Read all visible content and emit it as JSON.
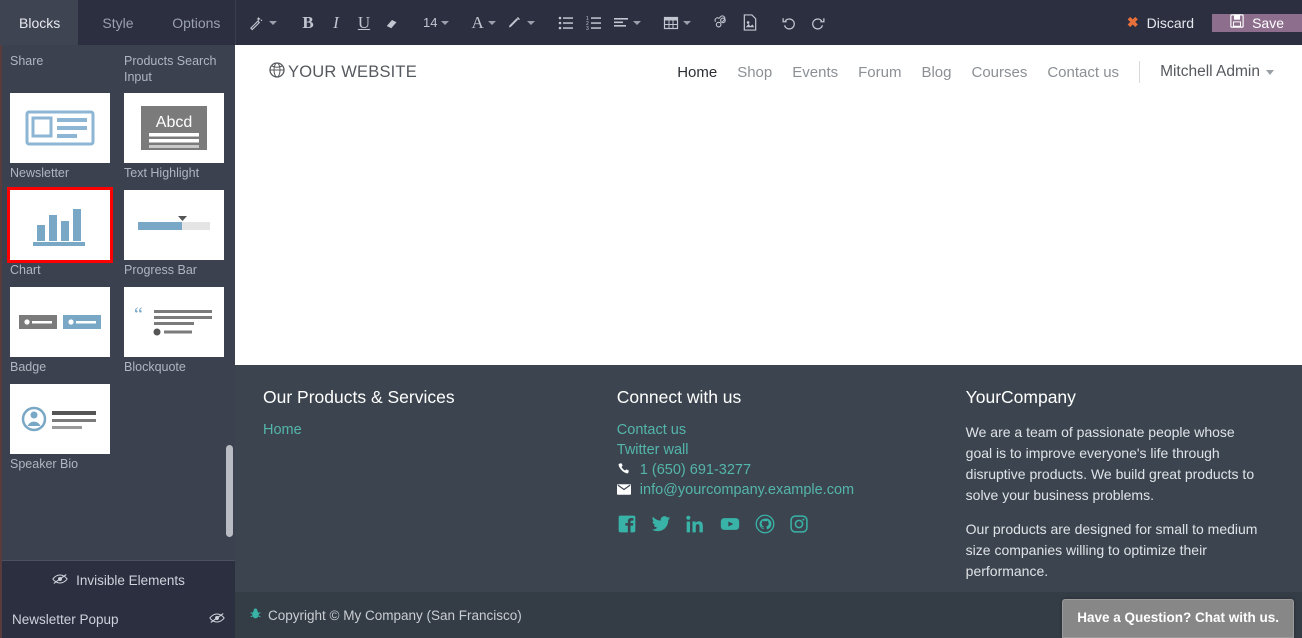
{
  "window": {
    "panel_tabs": [
      {
        "label": "Blocks",
        "active": true
      },
      {
        "label": "Style",
        "active": false
      },
      {
        "label": "Options",
        "active": false
      }
    ]
  },
  "toolbar": {
    "items": [
      {
        "name": "magic-wand-icon",
        "glyph": "✒",
        "caret": true
      },
      {
        "name": "bold-button",
        "glyph": "B",
        "caret": false
      },
      {
        "name": "italic-button",
        "glyph": "I",
        "caret": false
      },
      {
        "name": "underline-button",
        "glyph": "U",
        "caret": false
      },
      {
        "name": "remove-format-button",
        "glyph": "▱",
        "caret": false
      },
      {
        "name": "font-size-select",
        "glyph": "14",
        "caret": true
      },
      {
        "name": "font-color-button",
        "glyph": "A",
        "caret": true
      },
      {
        "name": "highlight-color-button",
        "glyph": "✎",
        "caret": true
      },
      {
        "name": "bulleted-list-button",
        "glyph": "☰",
        "caret": false
      },
      {
        "name": "numbered-list-button",
        "glyph": "≡",
        "caret": false
      },
      {
        "name": "align-button",
        "glyph": "≣",
        "caret": true
      },
      {
        "name": "table-button",
        "glyph": "▦",
        "caret": true
      },
      {
        "name": "link-button",
        "glyph": "ὑ7",
        "caret": false
      },
      {
        "name": "image-button",
        "glyph": "ὛB",
        "caret": false
      },
      {
        "name": "undo-button",
        "glyph": "↺",
        "caret": false
      },
      {
        "name": "redo-button",
        "glyph": "↻",
        "caret": false
      }
    ],
    "font_size_value": "14",
    "discard_label": "Discard",
    "save_label": "Save"
  },
  "blocks_panel": {
    "partial_top_labels": [
      "Share",
      "Products Search Input"
    ],
    "blocks": [
      {
        "label": "Newsletter",
        "icon": "newsletter-thumb",
        "selected": false
      },
      {
        "label": "Text Highlight",
        "icon": "text-highlight-thumb",
        "selected": false
      },
      {
        "label": "Chart",
        "icon": "chart-thumb",
        "selected": true
      },
      {
        "label": "Progress Bar",
        "icon": "progress-bar-thumb",
        "selected": false
      },
      {
        "label": "Badge",
        "icon": "badge-thumb",
        "selected": false
      },
      {
        "label": "Blockquote",
        "icon": "blockquote-thumb",
        "selected": false
      },
      {
        "label": "Speaker Bio",
        "icon": "speaker-bio-thumb",
        "selected": false
      }
    ],
    "invisible_elements_label": "Invisible Elements",
    "invisible_items": [
      {
        "label": "Newsletter Popup",
        "icon": "eye-slash-icon"
      }
    ]
  },
  "website": {
    "brand": "YOUR WEBSITE",
    "nav": [
      {
        "label": "Home",
        "active": true
      },
      {
        "label": "Shop",
        "active": false
      },
      {
        "label": "Events",
        "active": false
      },
      {
        "label": "Forum",
        "active": false
      },
      {
        "label": "Blog",
        "active": false
      },
      {
        "label": "Courses",
        "active": false
      },
      {
        "label": "Contact us",
        "active": false
      }
    ],
    "user": "Mitchell Admin",
    "footer": {
      "col1": {
        "title": "Our Products & Services",
        "links": [
          "Home"
        ]
      },
      "col2": {
        "title": "Connect with us",
        "links": [
          "Contact us",
          "Twitter wall"
        ],
        "phone": "1 (650) 691-3277",
        "email": "info@yourcompany.example.com",
        "socials": [
          "facebook-icon",
          "twitter-icon",
          "linkedin-icon",
          "youtube-icon",
          "github-icon",
          "instagram-icon"
        ]
      },
      "col3": {
        "title": "YourCompany",
        "paragraph1": "We are a team of passionate people whose goal is to improve everyone's life through disruptive products. We build great products to solve your business problems.",
        "paragraph2": "Our products are designed for small to medium size companies willing to optimize their performance."
      }
    },
    "copyright": "Copyright © My Company (San Francisco)",
    "chat_label": "Have a Question? Chat with us."
  },
  "colors": {
    "panel_bg": "#3c414f",
    "topbar_bg": "#2b2f3f",
    "save_bg": "#8d6e8d",
    "discard_icon": "#e8703a",
    "footer_bg": "#3c454f",
    "footer_link": "#54b5ab",
    "selection_outline": "#ff0000"
  }
}
